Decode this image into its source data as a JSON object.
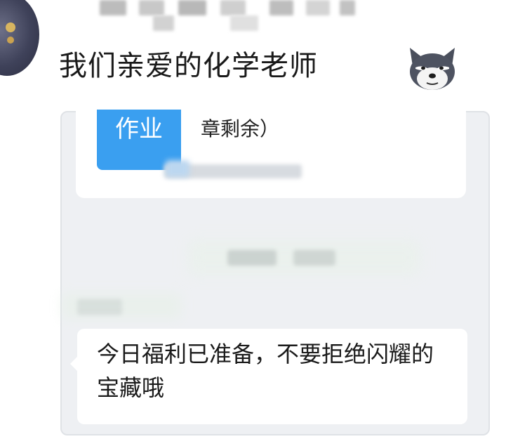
{
  "post": {
    "title": "我们亲爱的化学老师",
    "emoji": "dog-emoji"
  },
  "homework_card": {
    "badge": "作业",
    "text": "章剩余）"
  },
  "message": {
    "text": "今日福利已准备，不要拒绝闪耀的宝藏哦"
  },
  "colors": {
    "badge_blue": "#3a9ff0",
    "panel_bg": "#eef0f3"
  }
}
